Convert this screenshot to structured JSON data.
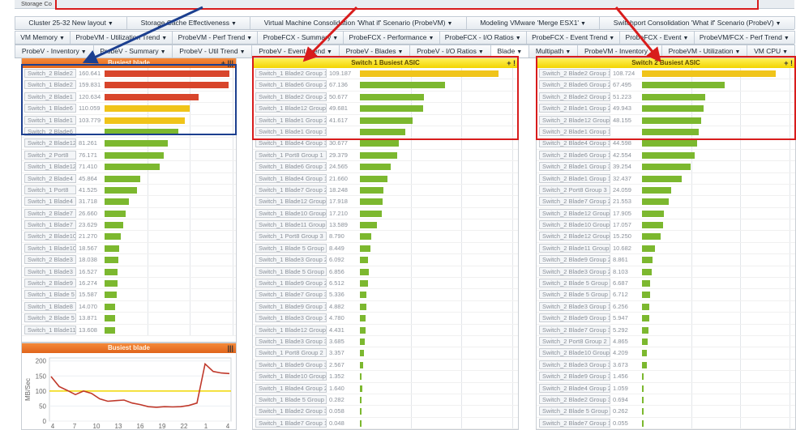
{
  "top_strip": {
    "label": "Storage Co"
  },
  "tabs_row1": [
    {
      "label": "Cluster 25-32 New layout"
    },
    {
      "label": "Storage Cache Effectiveness"
    },
    {
      "label": "Virtual Machine Consolidation 'What if' Scenario (ProbeVM)"
    },
    {
      "label": "Modeling VMware 'Merge ESX1'"
    },
    {
      "label": "Switchport Consolidation 'What if' Scenario (ProbeV)"
    }
  ],
  "tabs_row2": [
    {
      "label": "VM Memory"
    },
    {
      "label": "ProbeVM - Utilization Trend"
    },
    {
      "label": "ProbeVM - Perf Trend"
    },
    {
      "label": "ProbeFCX - Summary"
    },
    {
      "label": "ProbeFCX - Performance"
    },
    {
      "label": "ProbeFCX - I/O Ratios"
    },
    {
      "label": "ProbeFCX - Event Trend"
    },
    {
      "label": "ProbeFCX - Event"
    },
    {
      "label": "ProbeVM/FCX - Perf Trend"
    }
  ],
  "tabs_row3": [
    {
      "label": "ProbeV - Inventory"
    },
    {
      "label": "ProbeV - Summary"
    },
    {
      "label": "ProbeV - Util Trend"
    },
    {
      "label": "ProbeV - Event Trend"
    },
    {
      "label": "ProbeV - Blades"
    },
    {
      "label": "ProbeV - I/O Ratios"
    },
    {
      "label": "Blade"
    },
    {
      "label": "Multipath"
    },
    {
      "label": "ProbeVM - Inventory"
    },
    {
      "label": "ProbeVM - Utilization"
    },
    {
      "label": "VM CPU"
    }
  ],
  "colors": {
    "red": "#d8452b",
    "orange": "#e8742a",
    "yellow": "#f0c419",
    "green": "#7cb82f",
    "highlight_blue": "#1c3f8f",
    "highlight_red": "#d81c1c"
  },
  "busiest_blade": {
    "title": "Busiest blade",
    "controls": "+ |||",
    "max": 165000,
    "rows": [
      {
        "name": "Switch_2 Blade2",
        "value": "160.641",
        "num": 160641,
        "color": "red"
      },
      {
        "name": "Switch_1 Blade2",
        "value": "159.831",
        "num": 159831,
        "color": "red"
      },
      {
        "name": "Switch_2 Blade1",
        "value": "120.634",
        "num": 120634,
        "color": "red"
      },
      {
        "name": "Switch_1 Blade6",
        "value": "110.059",
        "num": 110059,
        "color": "yellow"
      },
      {
        "name": "Switch_1 Blade1",
        "value": "103.779",
        "num": 103779,
        "color": "yellow"
      },
      {
        "name": "Switch_2 Blade6",
        "value": "",
        "num": 95000,
        "color": "green"
      },
      {
        "name": "Switch_2 Blade12",
        "value": "81.261",
        "num": 81261,
        "color": "green"
      },
      {
        "name": "Switch_2 Port8",
        "value": "76.171",
        "num": 76171,
        "color": "green"
      },
      {
        "name": "Switch_1 Blade12",
        "value": "71.410",
        "num": 71410,
        "color": "green"
      },
      {
        "name": "Switch_2 Blade4",
        "value": "45.864",
        "num": 45864,
        "color": "green"
      },
      {
        "name": "Switch_1 Port8",
        "value": "41.525",
        "num": 41525,
        "color": "green"
      },
      {
        "name": "Switch_1 Blade4",
        "value": "31.718",
        "num": 31718,
        "color": "green"
      },
      {
        "name": "Switch_2 Blade7",
        "value": "26.660",
        "num": 26660,
        "color": "green"
      },
      {
        "name": "Switch_1 Blade7",
        "value": "23.629",
        "num": 23629,
        "color": "green"
      },
      {
        "name": "Switch_2 Blade10",
        "value": "21.270",
        "num": 21270,
        "color": "green"
      },
      {
        "name": "Switch_1 Blade10",
        "value": "18.567",
        "num": 18567,
        "color": "green"
      },
      {
        "name": "Switch_2 Blade3",
        "value": "18.038",
        "num": 18038,
        "color": "green"
      },
      {
        "name": "Switch_1 Blade3",
        "value": "16.527",
        "num": 16527,
        "color": "green"
      },
      {
        "name": "Switch_2 Blade9",
        "value": "16.274",
        "num": 16274,
        "color": "green"
      },
      {
        "name": "Switch_1 Blade 5",
        "value": "15.587",
        "num": 15587,
        "color": "green"
      },
      {
        "name": "Switch_1 Blade8",
        "value": "14.070",
        "num": 14070,
        "color": "green"
      },
      {
        "name": "Switch_2 Blade 5",
        "value": "13.871",
        "num": 13871,
        "color": "green"
      },
      {
        "name": "Switch_1 Blade11",
        "value": "13.608",
        "num": 13608,
        "color": "green"
      }
    ]
  },
  "switch1": {
    "title": "Switch 1 Busiest ASIC",
    "controls": "+ !",
    "max": 120000,
    "rows": [
      {
        "name": "Switch_1 Blade2 Group 1",
        "value": "109.187",
        "num": 109187,
        "color": "yellow"
      },
      {
        "name": "Switch_1 Blade6 Group 2",
        "value": "67.136",
        "num": 67136,
        "color": "green"
      },
      {
        "name": "Switch_1 Blade2 Group 2",
        "value": "50.677",
        "num": 50677,
        "color": "green"
      },
      {
        "name": "Switch_1 Blade12 Group 1",
        "value": "49.681",
        "num": 49681,
        "color": "green"
      },
      {
        "name": "Switch_1 Blade1 Group 2",
        "value": "41.617",
        "num": 41617,
        "color": "green"
      },
      {
        "name": "Switch_1 Blade1 Group 1",
        "value": "",
        "num": 36000,
        "color": "green"
      },
      {
        "name": "Switch_1 Blade4 Group 3",
        "value": "30.677",
        "num": 30677,
        "color": "green"
      },
      {
        "name": "Switch_1 Port8 Group 1",
        "value": "29.379",
        "num": 29379,
        "color": "green"
      },
      {
        "name": "Switch_1 Blade6 Group 1",
        "value": "24.565",
        "num": 24565,
        "color": "green"
      },
      {
        "name": "Switch_1 Blade4 Group 1",
        "value": "21.660",
        "num": 21660,
        "color": "green"
      },
      {
        "name": "Switch_1 Blade7 Group 2",
        "value": "18.248",
        "num": 18248,
        "color": "green"
      },
      {
        "name": "Switch_1 Blade12 Group 3",
        "value": "17.918",
        "num": 17918,
        "color": "green"
      },
      {
        "name": "Switch_1 Blade10 Group 2",
        "value": "17.210",
        "num": 17210,
        "color": "green"
      },
      {
        "name": "Switch_1 Blade11 Group 1",
        "value": "13.589",
        "num": 13589,
        "color": "green"
      },
      {
        "name": "Switch_1 Port8 Group 3",
        "value": "8.790",
        "num": 8790,
        "color": "green"
      },
      {
        "name": "Switch_1 Blade 5 Group 3",
        "value": "8.449",
        "num": 8449,
        "color": "green"
      },
      {
        "name": "Switch_1 Blade3 Group 2",
        "value": "6.092",
        "num": 6092,
        "color": "green"
      },
      {
        "name": "Switch_1 Blade 5 Group 2",
        "value": "6.856",
        "num": 6856,
        "color": "green"
      },
      {
        "name": "Switch_1 Blade9 Group 2",
        "value": "6.512",
        "num": 6512,
        "color": "green"
      },
      {
        "name": "Switch_1 Blade7 Group 3",
        "value": "5.336",
        "num": 5336,
        "color": "green"
      },
      {
        "name": "Switch_1 Blade9 Group 1",
        "value": "4.882",
        "num": 4882,
        "color": "green"
      },
      {
        "name": "Switch_1 Blade3 Group 1",
        "value": "4.780",
        "num": 4780,
        "color": "green"
      },
      {
        "name": "Switch_1 Blade12 Group 2",
        "value": "4.431",
        "num": 4431,
        "color": "green"
      },
      {
        "name": "Switch_1 Blade3 Group 3",
        "value": "3.685",
        "num": 3685,
        "color": "green"
      },
      {
        "name": "Switch_1 Port8 Group 2",
        "value": "3.357",
        "num": 3357,
        "color": "green"
      },
      {
        "name": "Switch_1 Blade9 Group 3",
        "value": "2.567",
        "num": 2567,
        "color": "green"
      },
      {
        "name": "Switch_1 Blade10 Group 1",
        "value": "1.352",
        "num": 1352,
        "color": "green"
      },
      {
        "name": "Switch_1 Blade4 Group 2",
        "value": "1.640",
        "num": 1640,
        "color": "green"
      },
      {
        "name": "Switch_1 Blade 5 Group 1",
        "value": "0.282",
        "num": 282,
        "color": "green"
      },
      {
        "name": "Switch_1 Blade2 Group 3",
        "value": "0.058",
        "num": 58,
        "color": "green"
      },
      {
        "name": "Switch_1 Blade7 Group 1",
        "value": "0.048",
        "num": 48,
        "color": "green"
      }
    ]
  },
  "switch2": {
    "title": "Switch 2 Busiest ASIC",
    "controls": "+ !",
    "max": 120000,
    "rows": [
      {
        "name": "Switch_2 Blade2 Group 1",
        "value": "108.724",
        "num": 108724,
        "color": "yellow"
      },
      {
        "name": "Switch_2 Blade6 Group 2",
        "value": "67.495",
        "num": 67495,
        "color": "green"
      },
      {
        "name": "Switch_2 Blade2 Group 2",
        "value": "51.223",
        "num": 51223,
        "color": "green"
      },
      {
        "name": "Switch_2 Blade1 Group 2",
        "value": "49.943",
        "num": 49943,
        "color": "green"
      },
      {
        "name": "Switch_2 Blade12 Group 1",
        "value": "48.155",
        "num": 48155,
        "color": "green"
      },
      {
        "name": "Switch_2 Blade1 Group 1",
        "value": "",
        "num": 46000,
        "color": "green"
      },
      {
        "name": "Switch_2 Blade4 Group 3",
        "value": "44.598",
        "num": 44598,
        "color": "green"
      },
      {
        "name": "Switch_2 Blade6 Group 1",
        "value": "42.554",
        "num": 42554,
        "color": "green"
      },
      {
        "name": "Switch_2 Blade1 Group 3",
        "value": "39.254",
        "num": 39254,
        "color": "green"
      },
      {
        "name": "Switch_2 Blade1 Group 1",
        "value": "32.437",
        "num": 32437,
        "color": "green"
      },
      {
        "name": "Switch_2 Port8 Group 3",
        "value": "24.059",
        "num": 24059,
        "color": "green"
      },
      {
        "name": "Switch_2 Blade7 Group 2",
        "value": "21.553",
        "num": 21553,
        "color": "green"
      },
      {
        "name": "Switch_2 Blade12 Group 3",
        "value": "17.905",
        "num": 17905,
        "color": "green"
      },
      {
        "name": "Switch_2 Blade10 Group 2",
        "value": "17.057",
        "num": 17057,
        "color": "green"
      },
      {
        "name": "Switch_2 Blade12 Group 2",
        "value": "15.250",
        "num": 15250,
        "color": "green"
      },
      {
        "name": "Switch_2 Blade11 Group 1",
        "value": "10.682",
        "num": 10682,
        "color": "green"
      },
      {
        "name": "Switch_2 Blade9 Group 2",
        "value": "8.861",
        "num": 8861,
        "color": "green"
      },
      {
        "name": "Switch_2 Blade3 Group 2",
        "value": "8.103",
        "num": 8103,
        "color": "green"
      },
      {
        "name": "Switch_2 Blade 5 Group 2",
        "value": "6.687",
        "num": 6687,
        "color": "green"
      },
      {
        "name": "Switch_2 Blade 5 Group 3",
        "value": "6.712",
        "num": 6712,
        "color": "green"
      },
      {
        "name": "Switch_2 Blade3 Group 1",
        "value": "6.256",
        "num": 6256,
        "color": "green"
      },
      {
        "name": "Switch_2 Blade9 Group 1",
        "value": "5.947",
        "num": 5947,
        "color": "green"
      },
      {
        "name": "Switch_2 Blade7 Group 3",
        "value": "5.292",
        "num": 5292,
        "color": "green"
      },
      {
        "name": "Switch_2 Port8 Group 2",
        "value": "4.865",
        "num": 4865,
        "color": "green"
      },
      {
        "name": "Switch_2 Blade10 Group 1",
        "value": "4.209",
        "num": 4209,
        "color": "green"
      },
      {
        "name": "Switch_2 Blade3 Group 3",
        "value": "3.673",
        "num": 3673,
        "color": "green"
      },
      {
        "name": "Switch_2 Blade9 Group 3",
        "value": "1.456",
        "num": 1456,
        "color": "green"
      },
      {
        "name": "Switch_2 Blade4 Group 2",
        "value": "1.059",
        "num": 1059,
        "color": "green"
      },
      {
        "name": "Switch_2 Blade2 Group 3",
        "value": "0.694",
        "num": 694,
        "color": "green"
      },
      {
        "name": "Switch_2 Blade 5 Group 1",
        "value": "0.262",
        "num": 262,
        "color": "green"
      },
      {
        "name": "Switch_2 Blade7 Group 1",
        "value": "0.055",
        "num": 55,
        "color": "green"
      }
    ]
  },
  "trend": {
    "title": "Busiest blade",
    "controls": "|||",
    "ylabel": "MB/Sec",
    "yticks": [
      "200",
      "150",
      "100",
      "50",
      "0"
    ],
    "xticks": [
      "4",
      "7",
      "10",
      "13",
      "16",
      "19",
      "22",
      "1",
      "4"
    ],
    "threshold": 100,
    "ylim": [
      0,
      210
    ],
    "values": [
      148,
      115,
      102,
      88,
      100,
      92,
      74,
      66,
      68,
      70,
      60,
      55,
      48,
      46,
      48,
      47,
      48,
      52,
      60,
      190,
      165,
      160,
      158
    ]
  }
}
